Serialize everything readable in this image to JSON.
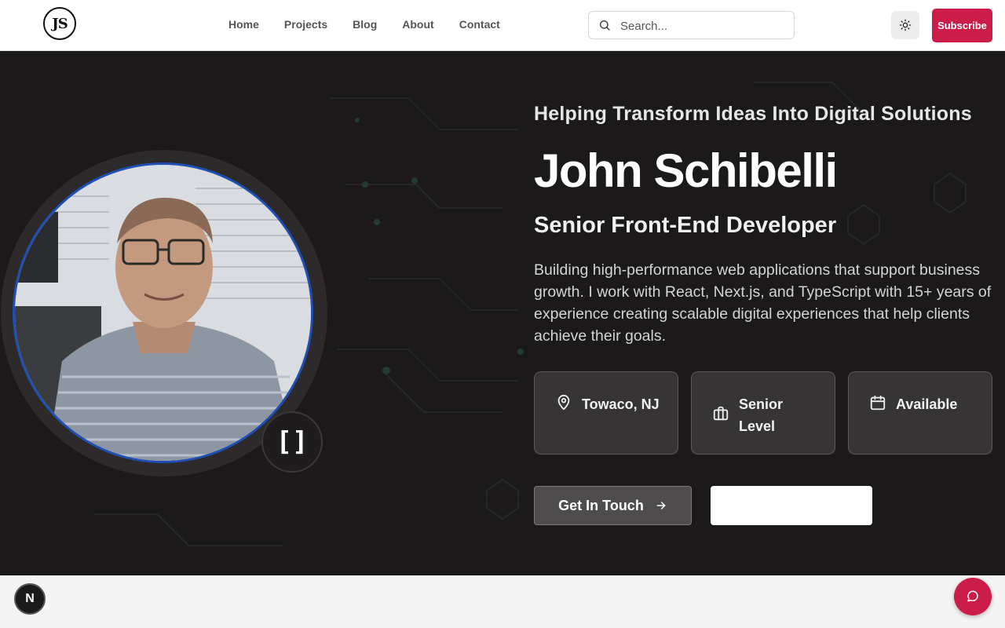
{
  "header": {
    "logo_text": "JS",
    "nav": [
      "Home",
      "Projects",
      "Blog",
      "About",
      "Contact"
    ],
    "search_placeholder": "Search...",
    "theme_icon": "sun-icon",
    "subscribe_label": "Subscribe"
  },
  "hero": {
    "tagline": "Helping Transform Ideas Into Digital Solutions",
    "name": "John Schibelli",
    "role": "Senior Front-End Developer",
    "bio": "Building high-performance web applications that support business growth. I work with React, Next.js, and TypeScript with 15+ years of experience creating scalable digital experiences that help clients achieve their goals.",
    "avatar_badge": "[]",
    "cards": [
      {
        "icon": "map-pin-icon",
        "label": "Towaco, NJ"
      },
      {
        "icon": "briefcase-icon",
        "label": "Senior Level"
      },
      {
        "icon": "calendar-icon",
        "label": "Available"
      }
    ],
    "cta_primary": "Get In Touch",
    "cta_secondary": ""
  },
  "floating": {
    "n_badge": "N",
    "chat_icon": "chat-bubble-icon"
  },
  "colors": {
    "accent": "#cc1d4a",
    "hero_bg": "#1b1919",
    "avatar_ring": "#1e4fb5"
  }
}
